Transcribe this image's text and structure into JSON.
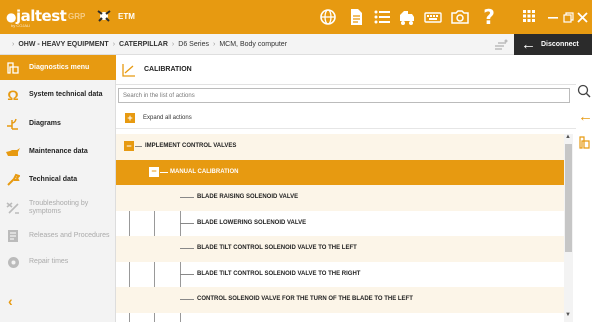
{
  "app": {
    "logo_text": "jaltest",
    "logo_sub": "by COJALI",
    "grp_label": "GRP",
    "etm_label": "ETM",
    "help_label": "?",
    "accent_color": "#e79a11",
    "dark_color": "#2b2b2b",
    "icons": [
      "lobster-logo-icon",
      "globe-icon",
      "document-icon",
      "list-icon",
      "truck-icon",
      "keyboard-icon",
      "camera-icon",
      "help-icon",
      "apps-grid-icon",
      "minimize-icon",
      "restore-icon",
      "close-icon"
    ]
  },
  "breadcrumb": {
    "items": [
      "OHW - HEAVY EQUIPMENT",
      "CATERPILLAR",
      "D6 Series",
      "MCM, Body computer"
    ],
    "separator": "›"
  },
  "disconnect": {
    "label": "Disconnect"
  },
  "sidebar": {
    "items": [
      {
        "label": "Diagnostics menu",
        "icon": "diagnostics-icon",
        "active": true,
        "enabled": true
      },
      {
        "label": "System technical data",
        "icon": "omega-icon",
        "active": false,
        "enabled": true
      },
      {
        "label": "Diagrams",
        "icon": "diagram-icon",
        "active": false,
        "enabled": true
      },
      {
        "label": "Maintenance data",
        "icon": "oil-can-icon",
        "active": false,
        "enabled": true
      },
      {
        "label": "Technical data",
        "icon": "wrench-icon",
        "active": false,
        "enabled": true
      },
      {
        "label": "Troubleshooting by symptoms",
        "icon": "troubleshoot-icon",
        "active": false,
        "enabled": false
      },
      {
        "label": "Releases and Procedures",
        "icon": "procedures-icon",
        "active": false,
        "enabled": false
      },
      {
        "label": "Repair times",
        "icon": "repair-times-icon",
        "active": false,
        "enabled": false
      }
    ],
    "back_label": "‹"
  },
  "main": {
    "section_title": "CALIBRATION",
    "search_placeholder": "Search in the list of actions",
    "expand_label": "Expand all actions",
    "expand_symbol": "+",
    "collapse_symbol": "−",
    "tree": [
      {
        "label": "IMPLEMENT CONTROL VALVES",
        "level": 0,
        "type": "group"
      },
      {
        "label": "MANUAL CALIBRATION",
        "level": 1,
        "type": "group",
        "highlighted": true
      },
      {
        "label": "BLADE RAISING SOLENOID VALVE",
        "level": 2,
        "type": "leaf"
      },
      {
        "label": "BLADE LOWERING SOLENOID VALVE",
        "level": 2,
        "type": "leaf"
      },
      {
        "label": "BLADE TILT CONTROL SOLENOID VALVE TO THE LEFT",
        "level": 2,
        "type": "leaf"
      },
      {
        "label": "BLADE TILT CONTROL SOLENOID VALVE TO THE RIGHT",
        "level": 2,
        "type": "leaf"
      },
      {
        "label": "CONTROL SOLENOID VALVE FOR THE TURN OF THE BLADE TO THE LEFT",
        "level": 2,
        "type": "leaf"
      }
    ]
  }
}
